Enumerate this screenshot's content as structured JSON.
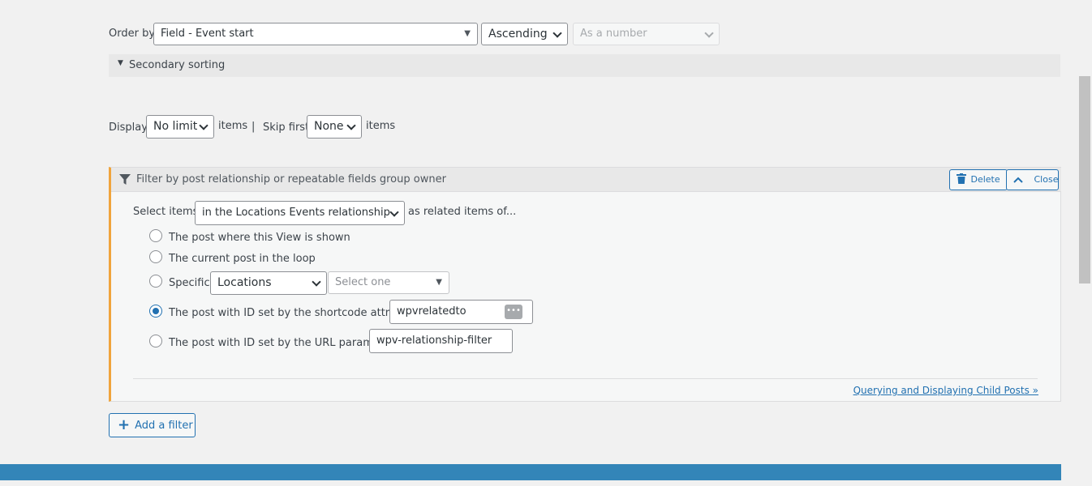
{
  "ordering": {
    "order_by_label": "Order by",
    "field_value": "Field - Event start",
    "direction_value": "Ascending",
    "type_value": "As a number",
    "secondary_sorting_label": "Secondary sorting"
  },
  "pagination": {
    "display_label": "Display",
    "display_value": "No limit",
    "items_label": "items",
    "separator": "|",
    "skip_first_label": "Skip first",
    "skip_value": "None",
    "items_label_2": "items"
  },
  "filter": {
    "title": "Filter by post relationship or repeatable fields group owner",
    "delete_label": "Delete",
    "close_label": "Close",
    "select_items_label": "Select items",
    "relationship_value": "in the Locations Events relationship",
    "related_of_label": "as related items of...",
    "options": {
      "post_where_shown": "The post where this View is shown",
      "current_post_loop": "The current post in the loop",
      "specific": "Specific:",
      "shortcode_attr": "The post with ID set by the shortcode attribute",
      "url_param": "The post with ID set by the URL parameter"
    },
    "specific_type_value": "Locations",
    "specific_post_placeholder": "Select one",
    "shortcode_value": "wpvrelatedto",
    "url_param_value": "wpv-relationship-filter",
    "help_link": "Querying and Displaying Child Posts »"
  },
  "add_filter_label": "Add a filter",
  "colors": {
    "accent": "#2271b1",
    "warning_border": "#f0a43c",
    "bottom_bar": "#3385b8"
  }
}
